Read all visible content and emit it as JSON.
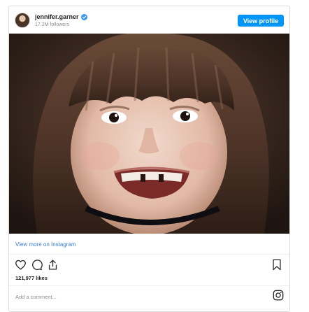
{
  "header": {
    "username": "jennifer.garner",
    "followers": "17.2M followers",
    "view_profile_label": "View profile",
    "avatar_icon": "profile-avatar",
    "verified_icon": "verified-badge-icon"
  },
  "post": {
    "image_alt": "",
    "view_more_label": "View more on Instagram",
    "likes": "121,977 likes"
  },
  "actions": {
    "like_icon": "heart-icon",
    "comment_icon": "comment-icon",
    "share_icon": "share-icon",
    "save_icon": "bookmark-icon",
    "instagram_icon": "instagram-icon"
  },
  "comment": {
    "placeholder": "Add a comment..."
  },
  "colors": {
    "accent": "#0095f6",
    "link": "#3a7bd5",
    "border": "#dbdbdb",
    "muted": "#8e8e8e"
  }
}
